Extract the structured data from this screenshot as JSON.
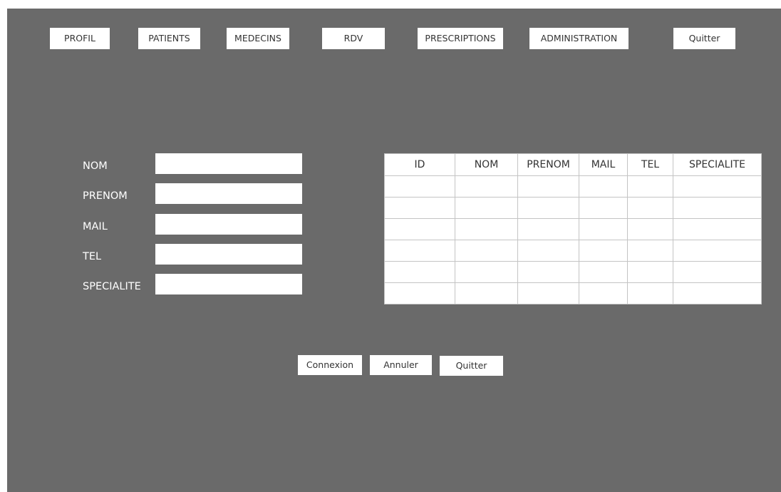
{
  "nav": {
    "profil": "PROFIL",
    "patients": "PATIENTS",
    "medecins": "MEDECINS",
    "rdv": "RDV",
    "prescriptions": "PRESCRIPTIONS",
    "administration": "ADMINISTRATION",
    "quitter": "Quitter"
  },
  "form": {
    "nom_label": "NOM",
    "prenom_label": "PRENOM",
    "mail_label": "MAIL",
    "tel_label": "TEL",
    "specialite_label": "SPECIALITE",
    "nom_value": "",
    "prenom_value": "",
    "mail_value": "",
    "tel_value": "",
    "specialite_value": ""
  },
  "table": {
    "headers": [
      "ID",
      "NOM",
      "PRENOM",
      "MAIL",
      "TEL",
      "SPECIALITE"
    ],
    "rows": [
      [
        "",
        "",
        "",
        "",
        "",
        ""
      ],
      [
        "",
        "",
        "",
        "",
        "",
        ""
      ],
      [
        "",
        "",
        "",
        "",
        "",
        ""
      ],
      [
        "",
        "",
        "",
        "",
        "",
        ""
      ],
      [
        "",
        "",
        "",
        "",
        "",
        ""
      ],
      [
        "",
        "",
        "",
        "",
        "",
        ""
      ]
    ]
  },
  "actions": {
    "connexion": "Connexion",
    "annuler": "Annuler",
    "quitter": "Quitter"
  },
  "colors": {
    "background": "#6a6a6a",
    "button": "#ffffff",
    "label": "#ffffff"
  }
}
